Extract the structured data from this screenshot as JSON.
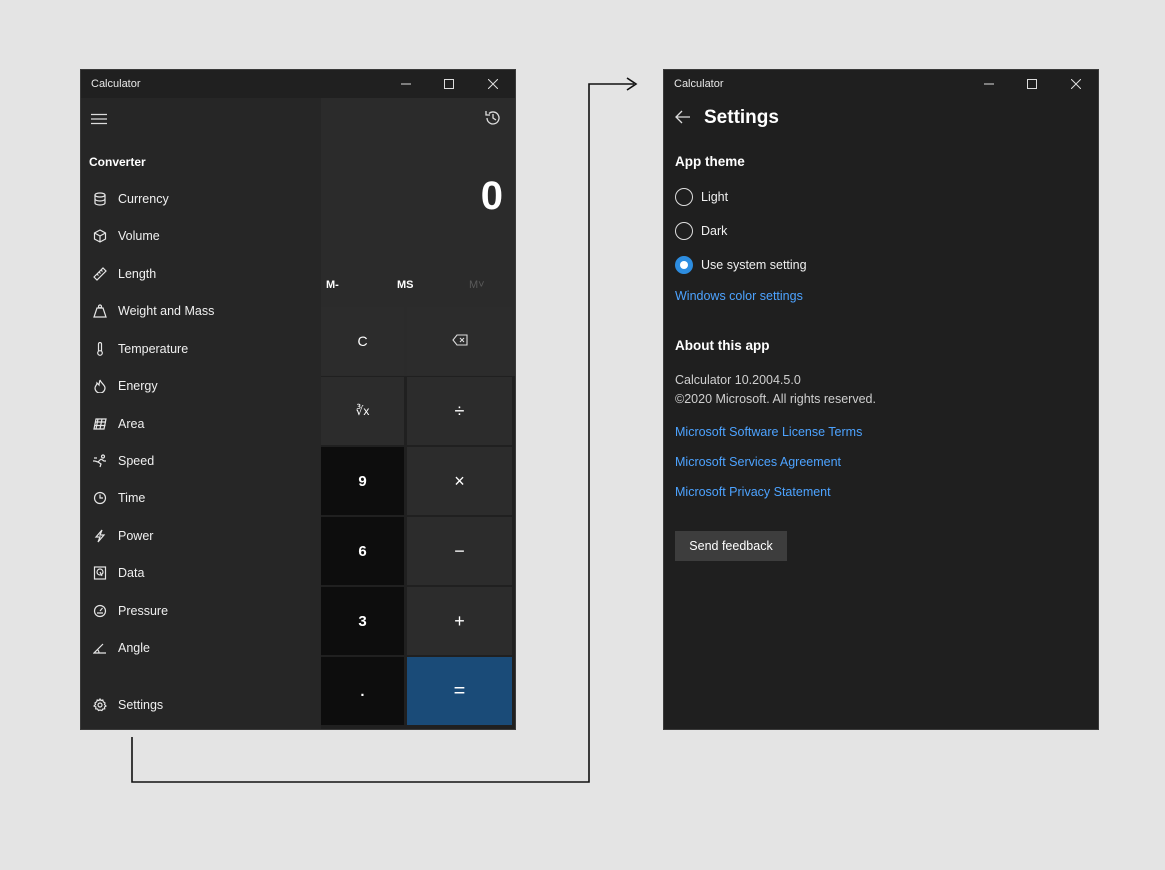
{
  "calculator": {
    "title": "Calculator",
    "display_value": "0",
    "memory": [
      "M-",
      "MS",
      "M˅"
    ],
    "keys": {
      "clear": "C",
      "root": "∛x",
      "divide": "÷",
      "multiply": "×",
      "minus": "−",
      "plus": "+",
      "equals": "=",
      "nine": "9",
      "six": "6",
      "three": "3",
      "dot": "."
    },
    "nav": {
      "section_title": "Converter",
      "items": [
        {
          "label": "Currency",
          "icon": "currency-icon"
        },
        {
          "label": "Volume",
          "icon": "cube-icon"
        },
        {
          "label": "Length",
          "icon": "ruler-icon"
        },
        {
          "label": "Weight and Mass",
          "icon": "weight-icon"
        },
        {
          "label": "Temperature",
          "icon": "thermometer-icon"
        },
        {
          "label": "Energy",
          "icon": "flame-icon"
        },
        {
          "label": "Area",
          "icon": "area-icon"
        },
        {
          "label": "Speed",
          "icon": "speed-icon"
        },
        {
          "label": "Time",
          "icon": "clock-icon"
        },
        {
          "label": "Power",
          "icon": "lightning-icon"
        },
        {
          "label": "Data",
          "icon": "data-icon"
        },
        {
          "label": "Pressure",
          "icon": "gauge-icon"
        },
        {
          "label": "Angle",
          "icon": "angle-icon"
        }
      ],
      "settings_label": "Settings"
    }
  },
  "settings": {
    "window_title": "Calculator",
    "title": "Settings",
    "app_theme": {
      "heading": "App theme",
      "options": [
        "Light",
        "Dark",
        "Use system setting"
      ],
      "selected": "Use system setting",
      "link": "Windows color settings"
    },
    "about": {
      "heading": "About this app",
      "version": "Calculator 10.2004.5.0",
      "copyright": "©2020 Microsoft. All rights reserved.",
      "links": [
        "Microsoft Software License Terms",
        "Microsoft Services Agreement",
        "Microsoft Privacy Statement"
      ]
    },
    "feedback_button": "Send feedback"
  },
  "colors": {
    "accent": "#2d8de0",
    "link": "#4da3ff",
    "equals_key": "#1a4b78",
    "background": "#e4e4e4"
  }
}
